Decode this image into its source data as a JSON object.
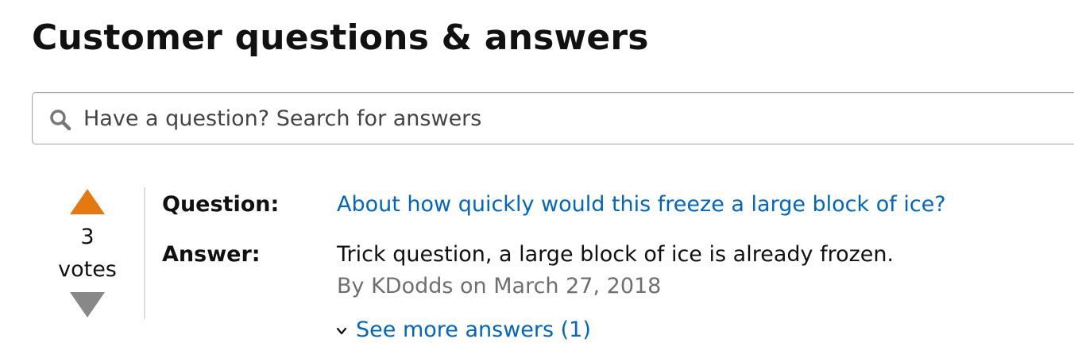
{
  "section": {
    "title": "Customer questions & answers"
  },
  "search": {
    "placeholder": "Have a question? Search for answers",
    "icon": "search-icon"
  },
  "qa": {
    "votes": {
      "count": "3",
      "label": "votes",
      "up_color": "#e47911",
      "down_color": "#888888"
    },
    "question_label": "Question:",
    "question_text": "About how quickly would this freeze a large block of ice?",
    "answer_label": "Answer:",
    "answer_text": "Trick question, a large block of ice is already frozen.",
    "answer_meta": "By KDodds on March 27, 2018",
    "see_more": "See more answers (1)"
  },
  "colors": {
    "link": "#0066c0",
    "meta": "#6f6f6f",
    "text": "#111111"
  }
}
